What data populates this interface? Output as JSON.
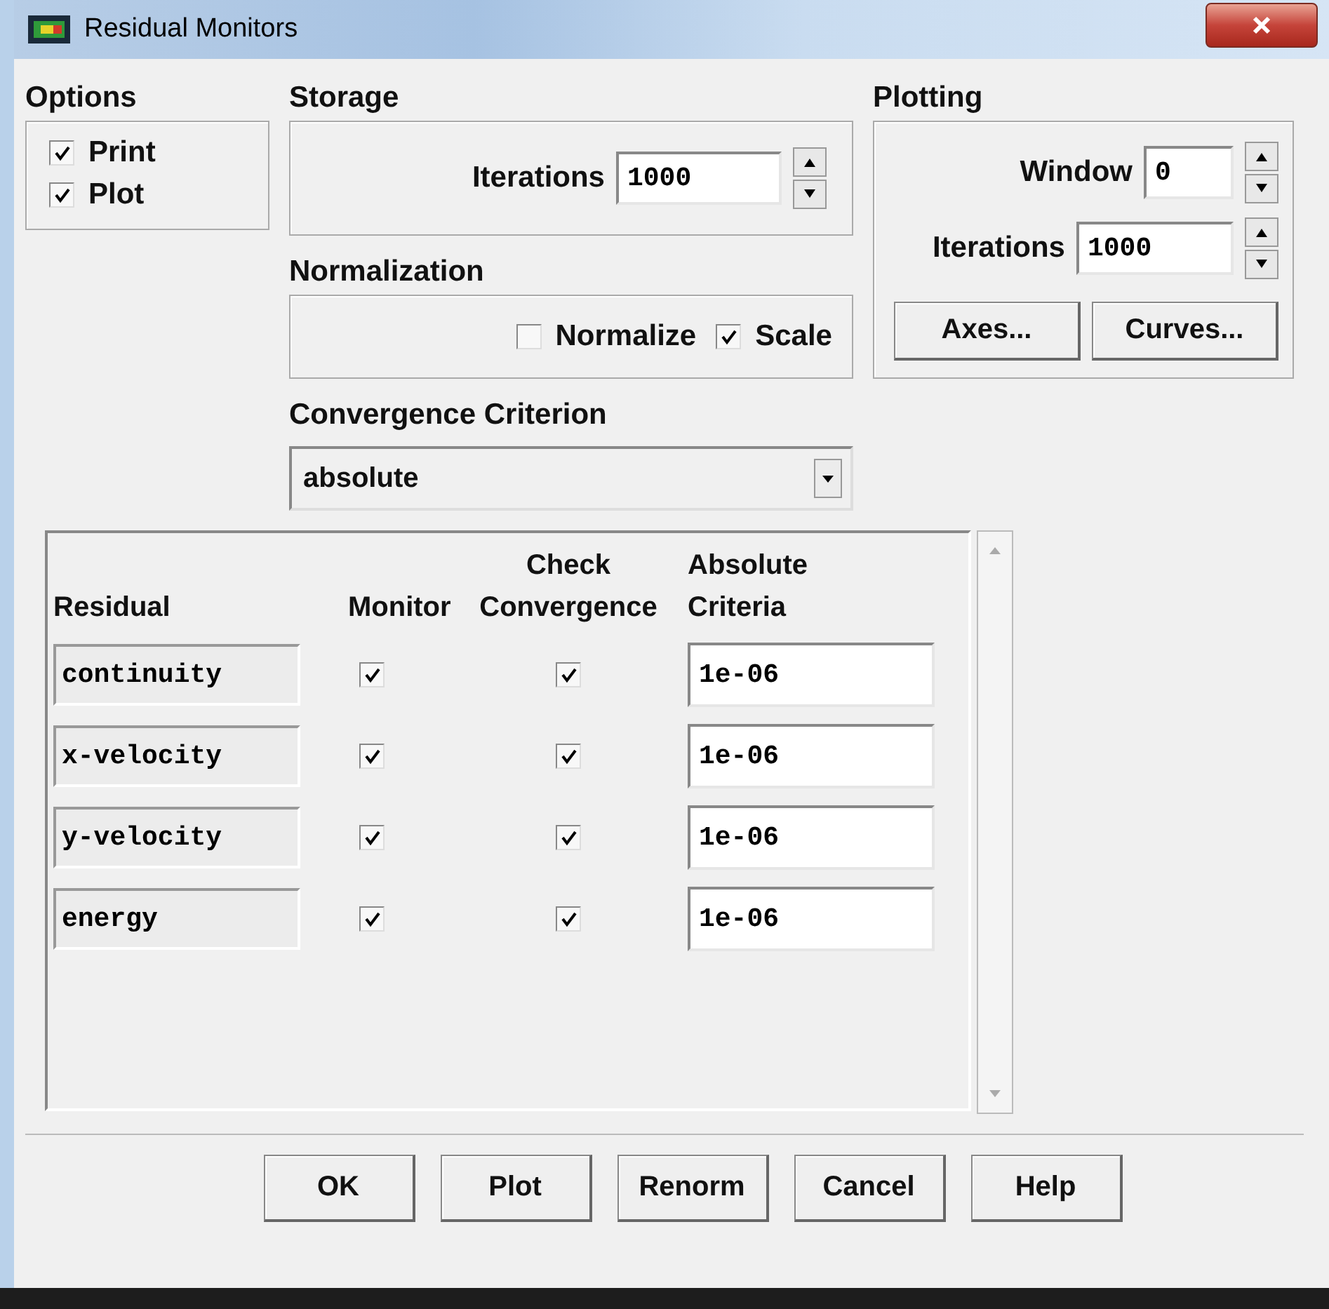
{
  "window": {
    "title": "Residual Monitors"
  },
  "options": {
    "label": "Options",
    "items": [
      {
        "label": "Print",
        "checked": true
      },
      {
        "label": "Plot",
        "checked": true
      }
    ]
  },
  "storage": {
    "label": "Storage",
    "iterations_label": "Iterations",
    "iterations": "1000"
  },
  "normalization": {
    "label": "Normalization",
    "items": [
      {
        "label": "Normalize",
        "checked": false
      },
      {
        "label": "Scale",
        "checked": true
      }
    ]
  },
  "convergence_criterion": {
    "label": "Convergence Criterion",
    "value": "absolute"
  },
  "plotting": {
    "label": "Plotting",
    "window_label": "Window",
    "window": "0",
    "iterations_label": "Iterations",
    "iterations": "1000",
    "buttons": [
      "Axes...",
      "Curves..."
    ]
  },
  "table": {
    "columns": [
      "Residual",
      "Monitor",
      "Check\nConvergence",
      "Absolute\nCriteria"
    ],
    "rows": [
      {
        "residual": "continuity",
        "monitor": true,
        "check_convergence": true,
        "criteria": "1e-06"
      },
      {
        "residual": "x-velocity",
        "monitor": true,
        "check_convergence": true,
        "criteria": "1e-06"
      },
      {
        "residual": "y-velocity",
        "monitor": true,
        "check_convergence": true,
        "criteria": "1e-06"
      },
      {
        "residual": "energy",
        "monitor": true,
        "check_convergence": true,
        "criteria": "1e-06"
      }
    ]
  },
  "buttons": [
    "OK",
    "Plot",
    "Renorm",
    "Cancel",
    "Help"
  ]
}
